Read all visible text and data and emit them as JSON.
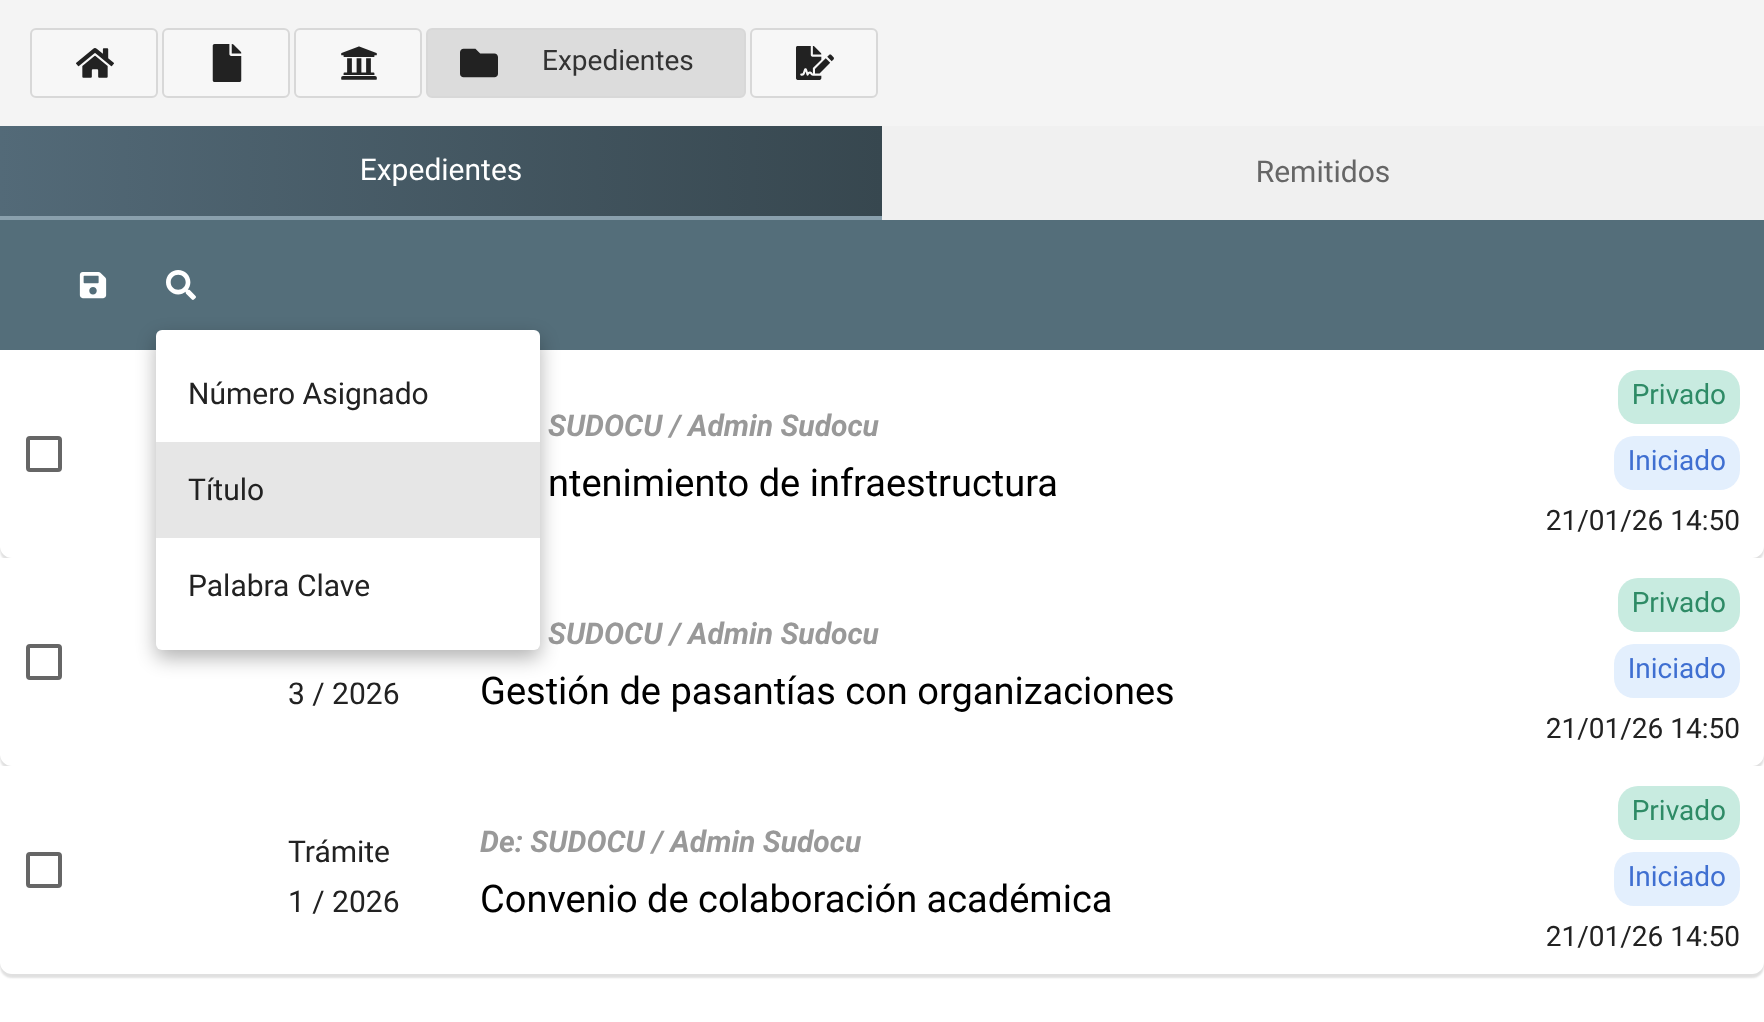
{
  "nav_buttons": [
    {
      "kind": "home",
      "selected": false
    },
    {
      "kind": "file",
      "selected": false
    },
    {
      "kind": "bank",
      "selected": false
    },
    {
      "kind": "folder",
      "label": "Expedientes",
      "selected": true
    },
    {
      "kind": "sign",
      "selected": false
    }
  ],
  "tabs": [
    {
      "label": "Expedientes",
      "selected": true
    },
    {
      "label": "Remitidos",
      "selected": false
    }
  ],
  "toolbar": [
    {
      "kind": "save"
    },
    {
      "kind": "search"
    }
  ],
  "search_menu": {
    "items": [
      {
        "label": "Número Asignado",
        "selected": false
      },
      {
        "label": "Título",
        "selected": true
      },
      {
        "label": "Palabra Clave",
        "selected": false
      }
    ]
  },
  "rows": [
    {
      "checked": false,
      "sender": "SUDOCU / Admin Sudocu",
      "title": "ntenimiento de infraestructura",
      "badges": [
        {
          "label": "Privado",
          "kind": "privacy"
        },
        {
          "label": "Iniciado",
          "kind": "status"
        }
      ],
      "date": "21/01/26 14:50"
    },
    {
      "checked": false,
      "number": "3 / 2026",
      "sender": "SUDOCU / Admin Sudocu",
      "title": "Gestión de pasantías con organizaciones",
      "badges": [
        {
          "label": "Privado",
          "kind": "privacy"
        },
        {
          "label": "Iniciado",
          "kind": "status"
        }
      ],
      "date": "21/01/26 14:50"
    },
    {
      "checked": false,
      "type": "Trámite",
      "number": "1 / 2026",
      "sender": "De: SUDOCU / Admin Sudocu",
      "title": "Convenio de colaboración académica",
      "badges": [
        {
          "label": "Privado",
          "kind": "privacy"
        },
        {
          "label": "Iniciado",
          "kind": "status"
        }
      ],
      "date": "21/01/26 14:50"
    }
  ]
}
